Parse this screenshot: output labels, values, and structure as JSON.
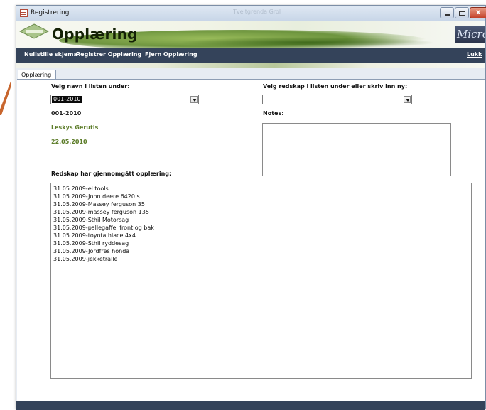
{
  "window": {
    "title": "Registrering",
    "center_title": "Tveitgrenda Grol"
  },
  "header": {
    "title": "Opplæring",
    "logo_text": "Tveitgrenda Grol",
    "brand": "Microf"
  },
  "toolbar": {
    "reset_label": "Nullstille skjema",
    "register_label": "Registrer Opplæring",
    "remove_label": "Fjern Opplæring",
    "close_label": "Lukk"
  },
  "tabs": [
    {
      "label": "Opplæring"
    }
  ],
  "form": {
    "name_label": "Velg navn i listen under:",
    "name_value": "001-2010",
    "id_text": "001-2010",
    "person_name": "Leskys Gerutis",
    "date_text": "22.05.2010",
    "equipment_label": "Velg redskap i listen under eller skriv inn ny:",
    "equipment_value": "",
    "notes_label": "Notes:",
    "notes_value": "",
    "trained_label": "Redskap har gjennomgått opplæring:",
    "trained_items": [
      "31.05.2009-el tools",
      "31.05.2009-John deere 6420 s",
      "31.05.2009-Massey ferguson 35",
      "31.05.2009-massey ferguson 135",
      "31.05.2009-Sthil Motorsag",
      "31.05.2009-pallegaffel front og bak",
      "31.05.2009-toyota hiace 4x4",
      "31.05.2009-Sthil ryddesag",
      "31.05.2009-Jordfres honda",
      "31.05.2009-jekketralle"
    ]
  },
  "colors": {
    "toolbar_bg": "#34435a",
    "accent_green": "#5d7d2a",
    "deco_arrow": "#c8662e"
  }
}
